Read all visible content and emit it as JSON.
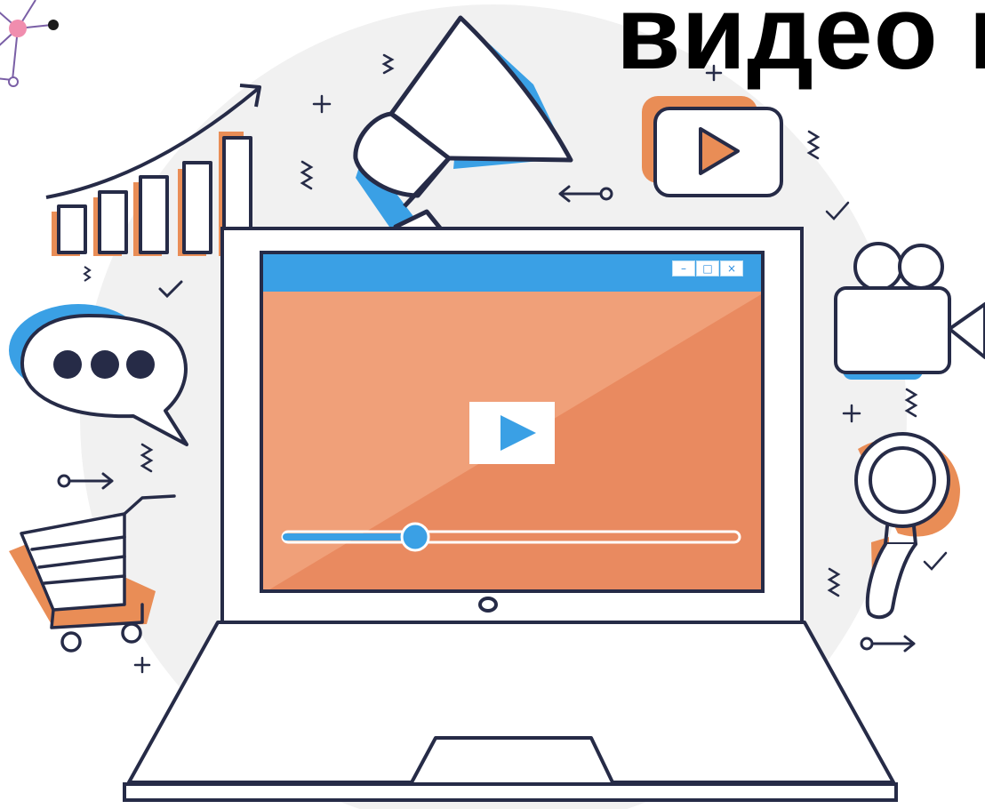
{
  "headline": "видео м",
  "colors": {
    "background": "#ffffff",
    "circle": "#f1f1f1",
    "outline": "#262b47",
    "blue_accent": "#3aa0e5",
    "orange_accent": "#e98d56",
    "screen_light": "#f0a079",
    "screen_dark": "#e98a60",
    "pink_node": "#f08dae",
    "node_line": "#7a5fa6"
  },
  "player": {
    "progress": 0.29,
    "play_icon": "play-triangle-icon",
    "window_controls": [
      "minimize-icon",
      "maximize-icon",
      "close-icon"
    ],
    "window_glyphs": [
      "–",
      "□",
      "×"
    ]
  },
  "icons": [
    "network-nodes-icon",
    "growth-bar-chart-icon",
    "megaphone-icon",
    "video-play-card-icon",
    "chat-bubble-icon",
    "shopping-cart-icon",
    "video-camera-icon",
    "magnifier-icon",
    "laptop-icon",
    "webcam-icon"
  ]
}
